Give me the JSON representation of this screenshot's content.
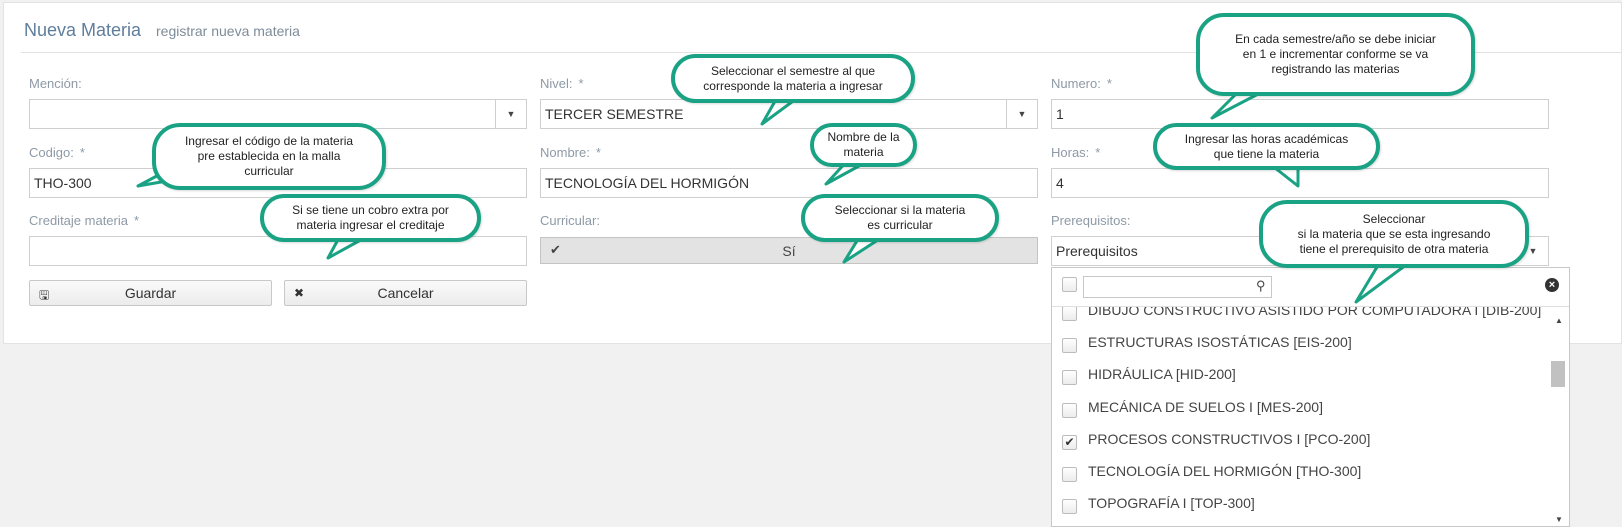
{
  "header": {
    "title": "Nueva Materia",
    "subtitle": "registrar nueva materia"
  },
  "form": {
    "mencion": {
      "label": "Mención:",
      "value": ""
    },
    "nivel": {
      "label": "Nivel:",
      "required": "*",
      "value": "TERCER SEMESTRE"
    },
    "numero": {
      "label": "Numero:",
      "required": "*",
      "value": "1"
    },
    "codigo": {
      "label": "Codigo:",
      "required": "*",
      "value": "THO-300"
    },
    "nombre": {
      "label": "Nombre:",
      "required": "*",
      "value": "TECNOLOGÍA DEL HORMIGÓN"
    },
    "horas": {
      "label": "Horas:",
      "required": "*",
      "value": "4"
    },
    "creditaje": {
      "label": "Creditaje materia",
      "required": "*",
      "value": ""
    },
    "curricular": {
      "label": "Curricular:",
      "value": "Sí"
    },
    "prerequisitos": {
      "label": "Prerequisitos:",
      "value": "Prerequisitos"
    },
    "buttons": {
      "save": "Guardar",
      "cancel": "Cancelar"
    }
  },
  "prereq_dropdown": {
    "search_placeholder": "",
    "items": [
      {
        "label": "DIBUJO CONSTRUCTIVO ASISTIDO POR COMPUTADORA I [DIB-200]",
        "checked": false
      },
      {
        "label": "ESTRUCTURAS ISOSTÁTICAS [EIS-200]",
        "checked": false
      },
      {
        "label": "HIDRÁULICA [HID-200]",
        "checked": false
      },
      {
        "label": "MECÁNICA DE SUELOS I [MES-200]",
        "checked": false
      },
      {
        "label": "PROCESOS CONSTRUCTIVOS I [PCO-200]",
        "checked": true
      },
      {
        "label": "TECNOLOGÍA DEL HORMIGÓN [THO-300]",
        "checked": false
      },
      {
        "label": "TOPOGRAFÍA I [TOP-300]",
        "checked": false
      }
    ]
  },
  "callouts": {
    "nivel": "Seleccionar el semestre al que\ncorresponde la materia a ingresar",
    "numero": "En cada semestre/año se debe iniciar\nen 1 e incrementar conforme se va\nregistrando las materias",
    "codigo": "Ingresar el código de la materia\npre establecida en la malla\ncurricular",
    "nombre": "Nombre de la\nmateria",
    "horas": "Ingresar las horas académicas\nque tiene la materia",
    "creditaje": "Si se tiene un cobro extra por\nmateria ingresar el creditaje",
    "curricular": "Seleccionar si la materia\nes curricular",
    "prerequisitos": "Seleccionar\nsi la materia que se esta ingresando\ntiene el prerequisito de otra materia"
  },
  "colors": {
    "callout_border": "#1aa284",
    "label": "#8e9aa6",
    "title": "#5f7e9c"
  }
}
